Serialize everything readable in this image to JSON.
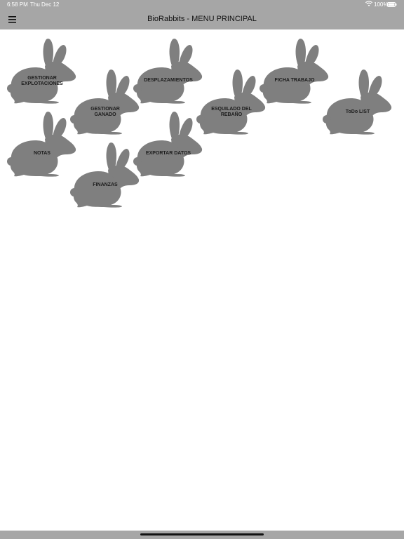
{
  "status_bar": {
    "time": "6:58 PM",
    "date": "Thu Dec 12",
    "battery": "100%"
  },
  "nav": {
    "title": "BioRabbits - MENU PRINCIPAL"
  },
  "menu": {
    "gestionar_explotaciones": "GESTIONAR EXPLOTACIONES",
    "gestionar_ganado": "GESTIONAR GANADO",
    "desplazamientos": "DESPLAZAMIENTOS",
    "esquilado": "ESQUILADO DEL REBAÑO",
    "ficha_trabajo": "FICHA TRABAJO",
    "todo_list": "ToDo LIST",
    "notas": "NOTAS",
    "exportar_datos": "EXPORTAR DATOS",
    "finanzas": "FINANZAS"
  },
  "colors": {
    "bars": "#a6a6a6",
    "rabbit": "#7f7f7f"
  }
}
